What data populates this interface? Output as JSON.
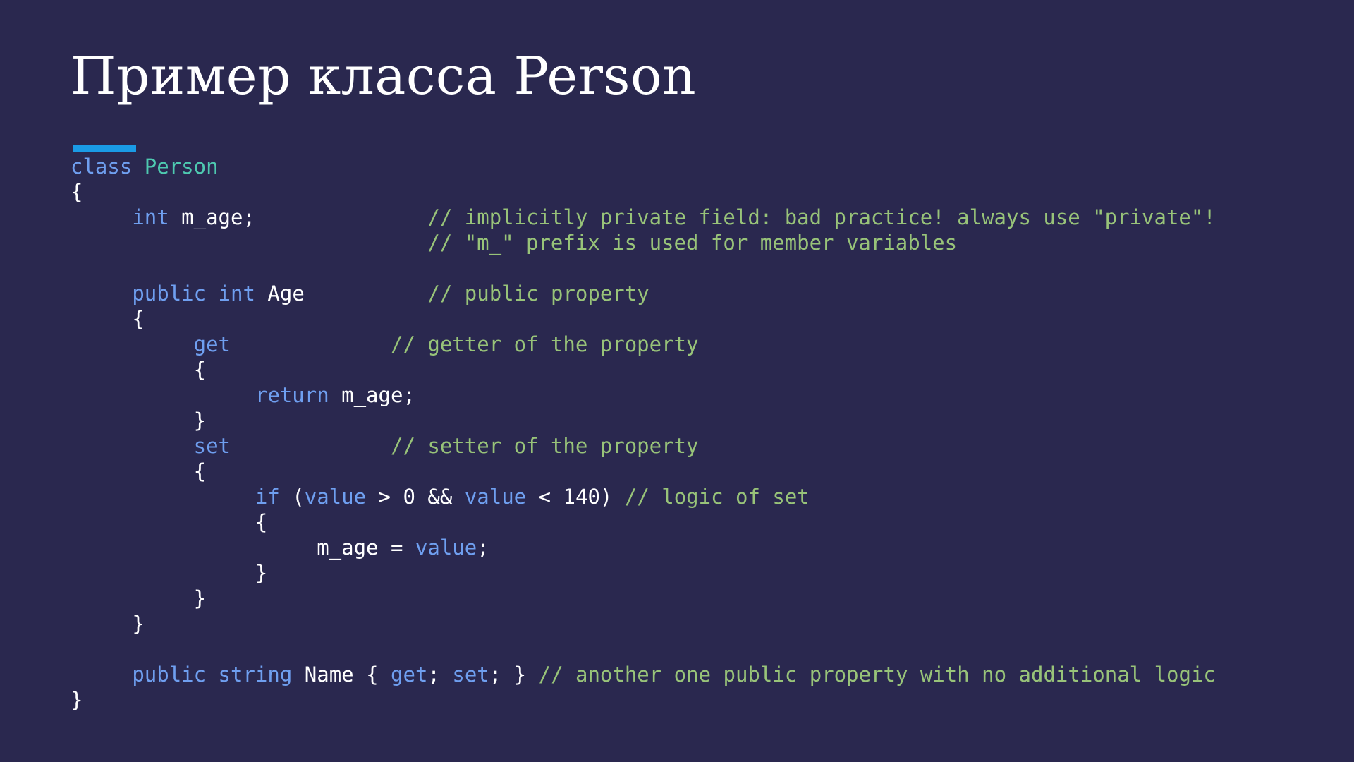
{
  "slide": {
    "title": "Пример класса Person"
  },
  "colors": {
    "background": "#2a284f",
    "title": "#ffffff",
    "accent_bar": "#1a9be6",
    "keyword": "#6f9ff0",
    "type_name": "#4ec9b0",
    "identifier": "#ffffff",
    "comment": "#98c379"
  },
  "code": {
    "language": "csharp",
    "lines": [
      [
        [
          "kw",
          "class"
        ],
        [
          "sp",
          " "
        ],
        [
          "type",
          "Person"
        ]
      ],
      [
        [
          "punc",
          "{"
        ]
      ],
      [
        [
          "sp",
          "     "
        ],
        [
          "kw",
          "int"
        ],
        [
          "sp",
          " "
        ],
        [
          "id",
          "m_age"
        ],
        [
          "punc",
          ";"
        ],
        [
          "sp",
          "              "
        ],
        [
          "comment",
          "// implicitly private field: bad practice! always use \"private\"!"
        ]
      ],
      [
        [
          "sp",
          "                             "
        ],
        [
          "comment",
          "// \"m_\" prefix is used for member variables"
        ]
      ],
      [],
      [
        [
          "sp",
          "     "
        ],
        [
          "kw",
          "public"
        ],
        [
          "sp",
          " "
        ],
        [
          "kw",
          "int"
        ],
        [
          "sp",
          " "
        ],
        [
          "id",
          "Age"
        ],
        [
          "sp",
          "          "
        ],
        [
          "comment",
          "// public property"
        ]
      ],
      [
        [
          "sp",
          "     "
        ],
        [
          "punc",
          "{"
        ]
      ],
      [
        [
          "sp",
          "          "
        ],
        [
          "kw",
          "get"
        ],
        [
          "sp",
          "             "
        ],
        [
          "comment",
          "// getter of the property"
        ]
      ],
      [
        [
          "sp",
          "          "
        ],
        [
          "punc",
          "{"
        ]
      ],
      [
        [
          "sp",
          "               "
        ],
        [
          "kw",
          "return"
        ],
        [
          "sp",
          " "
        ],
        [
          "id",
          "m_age"
        ],
        [
          "punc",
          ";"
        ]
      ],
      [
        [
          "sp",
          "          "
        ],
        [
          "punc",
          "}"
        ]
      ],
      [
        [
          "sp",
          "          "
        ],
        [
          "kw",
          "set"
        ],
        [
          "sp",
          "             "
        ],
        [
          "comment",
          "// setter of the property"
        ]
      ],
      [
        [
          "sp",
          "          "
        ],
        [
          "punc",
          "{"
        ]
      ],
      [
        [
          "sp",
          "               "
        ],
        [
          "kw",
          "if"
        ],
        [
          "sp",
          " "
        ],
        [
          "punc",
          "("
        ],
        [
          "kw",
          "value"
        ],
        [
          "sp",
          " "
        ],
        [
          "punc",
          ">"
        ],
        [
          "sp",
          " "
        ],
        [
          "id",
          "0"
        ],
        [
          "sp",
          " "
        ],
        [
          "punc",
          "&&"
        ],
        [
          "sp",
          " "
        ],
        [
          "kw",
          "value"
        ],
        [
          "sp",
          " "
        ],
        [
          "punc",
          "<"
        ],
        [
          "sp",
          " "
        ],
        [
          "id",
          "140"
        ],
        [
          "punc",
          ")"
        ],
        [
          "sp",
          " "
        ],
        [
          "comment",
          "// logic of set"
        ]
      ],
      [
        [
          "sp",
          "               "
        ],
        [
          "punc",
          "{"
        ]
      ],
      [
        [
          "sp",
          "                    "
        ],
        [
          "id",
          "m_age"
        ],
        [
          "sp",
          " "
        ],
        [
          "punc",
          "="
        ],
        [
          "sp",
          " "
        ],
        [
          "kw",
          "value"
        ],
        [
          "punc",
          ";"
        ]
      ],
      [
        [
          "sp",
          "               "
        ],
        [
          "punc",
          "}"
        ]
      ],
      [
        [
          "sp",
          "          "
        ],
        [
          "punc",
          "}"
        ]
      ],
      [
        [
          "sp",
          "     "
        ],
        [
          "punc",
          "}"
        ]
      ],
      [],
      [
        [
          "sp",
          "     "
        ],
        [
          "kw",
          "public"
        ],
        [
          "sp",
          " "
        ],
        [
          "kw",
          "string"
        ],
        [
          "sp",
          " "
        ],
        [
          "id",
          "Name"
        ],
        [
          "sp",
          " "
        ],
        [
          "punc",
          "{"
        ],
        [
          "sp",
          " "
        ],
        [
          "kw",
          "get"
        ],
        [
          "punc",
          ";"
        ],
        [
          "sp",
          " "
        ],
        [
          "kw",
          "set"
        ],
        [
          "punc",
          ";"
        ],
        [
          "sp",
          " "
        ],
        [
          "punc",
          "}"
        ],
        [
          "sp",
          " "
        ],
        [
          "comment",
          "// another one public property with no additional logic"
        ]
      ],
      [
        [
          "punc",
          "}"
        ]
      ]
    ]
  }
}
